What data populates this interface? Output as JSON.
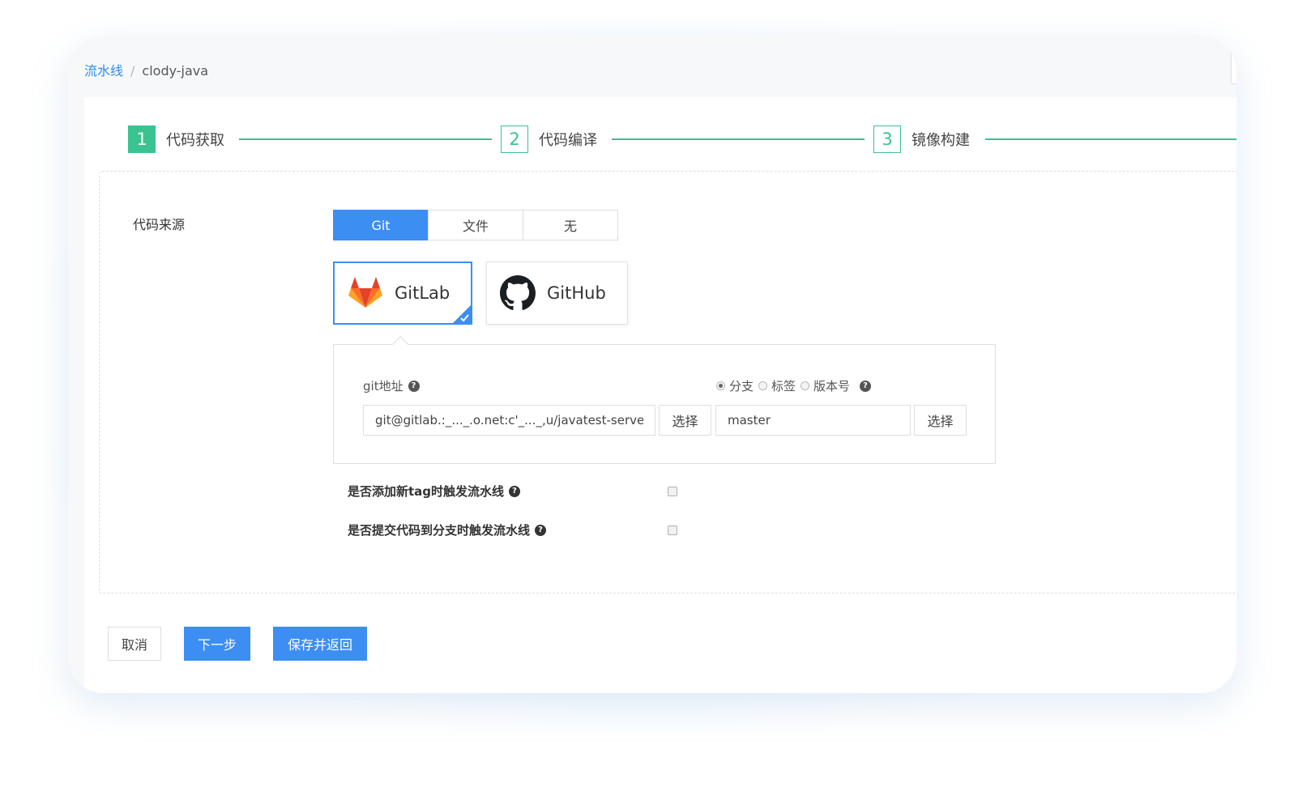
{
  "breadcrumb": {
    "parent": "流水线",
    "separator": "/",
    "current": "clody-java"
  },
  "steps": [
    {
      "number": "1",
      "label": "代码获取"
    },
    {
      "number": "2",
      "label": "代码编译"
    },
    {
      "number": "3",
      "label": "镜像构建"
    }
  ],
  "source": {
    "label": "代码来源",
    "options": [
      "Git",
      "文件",
      "无"
    ],
    "selected": "Git"
  },
  "providers": [
    {
      "name": "GitLab",
      "icon": "gitlab-icon",
      "selected": true
    },
    {
      "name": "GitHub",
      "icon": "github-icon",
      "selected": false
    }
  ],
  "git": {
    "address_label": "git地址",
    "address_value": "git@gitlab.:_..._.o.net:c'_..._,u/javatest-serve",
    "select_label": "选择",
    "ref_options": [
      "分支",
      "标签",
      "版本号"
    ],
    "ref_selected": "分支",
    "ref_value": "master",
    "ref_select_label": "选择"
  },
  "triggers": [
    {
      "label": "是否添加新tag时触发流水线",
      "checked": false
    },
    {
      "label": "是否提交代码到分支时触发流水线",
      "checked": false
    }
  ],
  "footer": {
    "cancel": "取消",
    "next": "下一步",
    "save": "保存并返回"
  },
  "colors": {
    "primary": "#3c8ef3",
    "step": "#3bc291",
    "link": "#2d8cf0"
  }
}
